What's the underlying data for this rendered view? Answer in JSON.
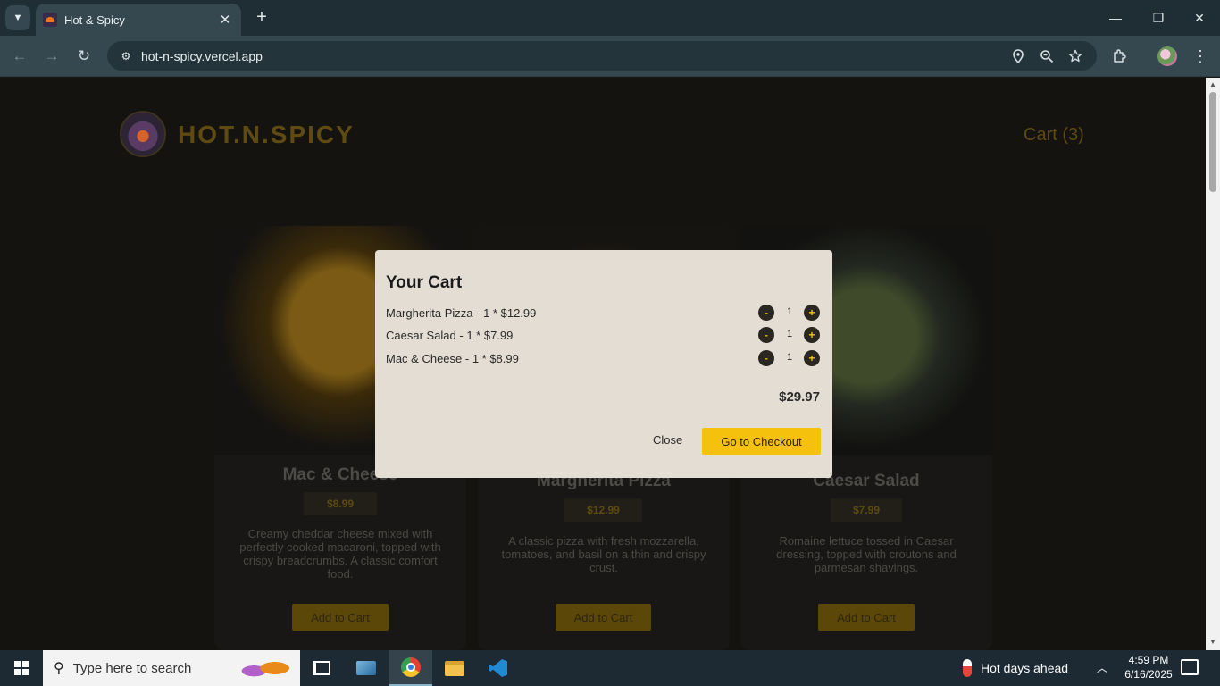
{
  "browser": {
    "tab_title": "Hot & Spicy",
    "tab_close": "✕",
    "new_tab": "+",
    "url": "hot-n-spicy.vercel.app",
    "window_controls": {
      "minimize": "—",
      "restore": "❐",
      "close": "✕"
    }
  },
  "site": {
    "brand": "HOT.N.SPICY",
    "cart_link": "Cart (3)"
  },
  "menu": [
    {
      "title": "Mac & Cheese",
      "price": "$8.99",
      "description": "Creamy cheddar cheese mixed with perfectly cooked macaroni, topped with crispy breadcrumbs. A classic comfort food.",
      "button": "Add to Cart"
    },
    {
      "title": "Margherita Pizza",
      "price": "$12.99",
      "description": "A classic pizza with fresh mozzarella, tomatoes, and basil on a thin and crispy crust.",
      "button": "Add to Cart"
    },
    {
      "title": "Caesar Salad",
      "price": "$7.99",
      "description": "Romaine lettuce tossed in Caesar dressing, topped with croutons and parmesan shavings.",
      "button": "Add to Cart"
    }
  ],
  "cart_modal": {
    "title": "Your Cart",
    "items": [
      {
        "text": "Margherita Pizza - 1 * $12.99",
        "qty": "1",
        "minus": "-",
        "plus": "+"
      },
      {
        "text": "Caesar Salad - 1 * $7.99",
        "qty": "1",
        "minus": "-",
        "plus": "+"
      },
      {
        "text": "Mac & Cheese - 1 * $8.99",
        "qty": "1",
        "minus": "-",
        "plus": "+"
      }
    ],
    "total": "$29.97",
    "close_label": "Close",
    "checkout_label": "Go to Checkout"
  },
  "taskbar": {
    "search_placeholder": "Type here to search",
    "weather": "Hot days ahead",
    "time": "4:59 PM",
    "date": "6/16/2025"
  },
  "colors": {
    "accent": "#f5c10c",
    "brand_dimmed": "#5f4a12",
    "modal_bg": "#e4ddd4"
  }
}
